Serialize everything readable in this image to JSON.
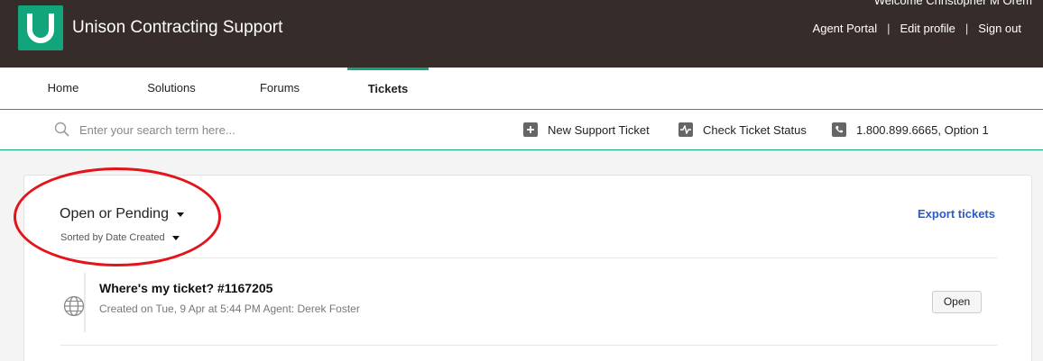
{
  "header": {
    "site_title": "Unison Contracting Support",
    "welcome": "Welcome Christopher M Orem",
    "links": {
      "agent_portal": "Agent Portal",
      "edit_profile": "Edit profile",
      "sign_out": "Sign out",
      "separator": "|"
    },
    "colors": {
      "background": "#362d2b",
      "brand": "#12a57c"
    }
  },
  "nav": {
    "items": [
      "Home",
      "Solutions",
      "Forums",
      "Tickets"
    ],
    "active": "Tickets"
  },
  "search": {
    "placeholder": "Enter your search term here...",
    "actions": {
      "new_ticket": "New Support Ticket",
      "check_status": "Check Ticket Status",
      "phone": "1.800.899.6665, Option 1"
    }
  },
  "tickets": {
    "filter_label": "Open or Pending",
    "sort_label": "Sorted by Date Created",
    "export_label": "Export tickets",
    "list": [
      {
        "title": "Where's my ticket? #1167205",
        "meta": "Created on Tue, 9 Apr at 5:44 PM Agent: Derek Foster",
        "status": "Open"
      }
    ]
  },
  "icons": {
    "search": "search-icon",
    "new_ticket": "plus-icon",
    "check_status": "pulse-icon",
    "phone": "phone-icon",
    "ticket_source": "globe-icon"
  }
}
